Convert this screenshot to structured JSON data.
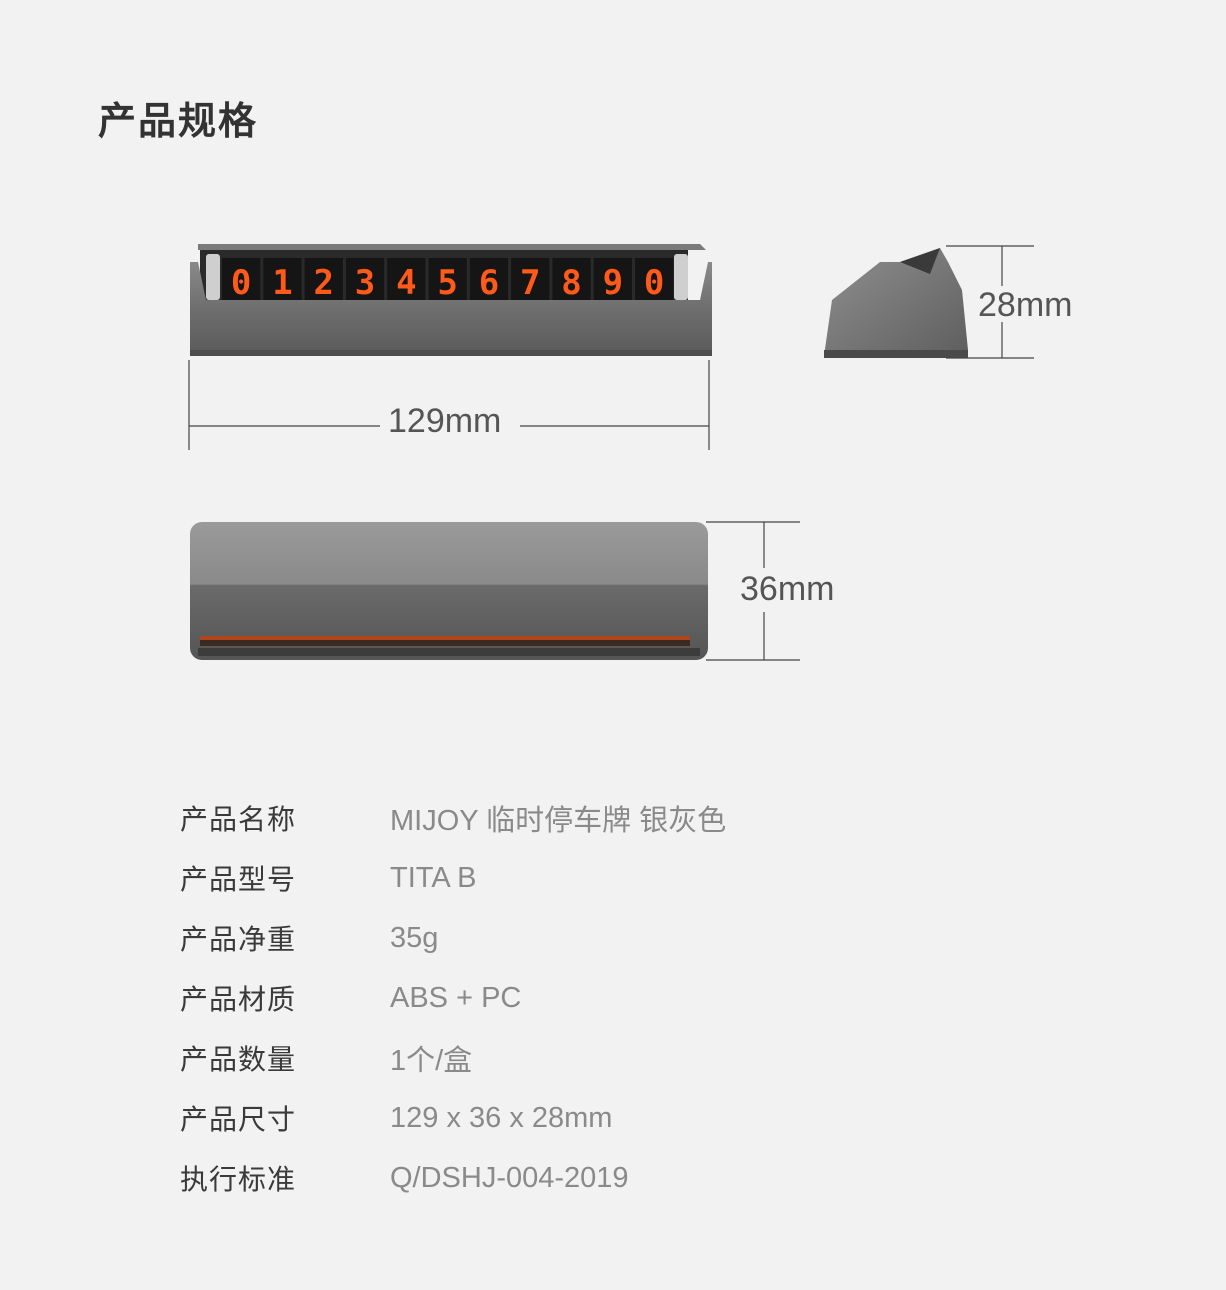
{
  "title": "产品规格",
  "dimensions": {
    "length": "129mm",
    "height": "28mm",
    "width": "36mm"
  },
  "display_digits": [
    "0",
    "1",
    "2",
    "3",
    "4",
    "5",
    "6",
    "7",
    "8",
    "9",
    "0"
  ],
  "colors": {
    "digit": "#ff5a1a",
    "body": "#6b6b6b",
    "background": "#f2f2f2"
  },
  "specs": [
    {
      "label": "产品名称",
      "value": "MIJOY 临时停车牌 银灰色"
    },
    {
      "label": "产品型号",
      "value": "TITA B"
    },
    {
      "label": "产品净重",
      "value": "35g"
    },
    {
      "label": "产品材质",
      "value": "ABS + PC"
    },
    {
      "label": "产品数量",
      "value": "1个/盒"
    },
    {
      "label": "产品尺寸",
      "value": "129 x 36 x 28mm"
    },
    {
      "label": "执行标准",
      "value": "Q/DSHJ-004-2019"
    }
  ]
}
